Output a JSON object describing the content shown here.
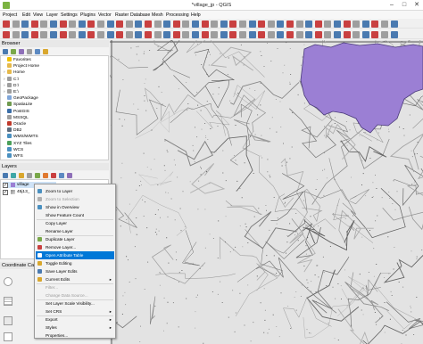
{
  "window": {
    "title": "*village_jp - QGIS",
    "minimize": "–",
    "maximize": "□",
    "close": "✕"
  },
  "menu": [
    "Project",
    "Edit",
    "View",
    "Layer",
    "Settings",
    "Plugins",
    "Vector",
    "Raster",
    "Database",
    "Mesh",
    "Processing",
    "Help"
  ],
  "browser": {
    "title": "Browser",
    "items": [
      {
        "label": "Favorites",
        "icon": "star-icon",
        "color": "#f2c200",
        "arrow": ""
      },
      {
        "label": "Project Home",
        "icon": "folder-icon",
        "color": "#e6b94a",
        "arrow": ""
      },
      {
        "label": "Home",
        "icon": "folder-icon",
        "color": "#e6b94a",
        "arrow": "›"
      },
      {
        "label": "C:\\",
        "icon": "drive-icon",
        "color": "#9e9e9e",
        "arrow": "›"
      },
      {
        "label": "D:\\",
        "icon": "drive-icon",
        "color": "#9e9e9e",
        "arrow": "›"
      },
      {
        "label": "E:\\",
        "icon": "drive-icon",
        "color": "#9e9e9e",
        "arrow": "›"
      },
      {
        "label": "GeoPackage",
        "icon": "geopackage-icon",
        "color": "#7fa6d9",
        "arrow": ""
      },
      {
        "label": "SpatiaLite",
        "icon": "spatialite-icon",
        "color": "#6f9a4f",
        "arrow": ""
      },
      {
        "label": "PostGIS",
        "icon": "postgis-icon",
        "color": "#3b6ea8",
        "arrow": ""
      },
      {
        "label": "MSSQL",
        "icon": "mssql-icon",
        "color": "#9e9e9e",
        "arrow": ""
      },
      {
        "label": "Oracle",
        "icon": "oracle-icon",
        "color": "#c0392b",
        "arrow": ""
      },
      {
        "label": "DB2",
        "icon": "db2-icon",
        "color": "#5d6d7e",
        "arrow": ""
      },
      {
        "label": "WMS/WMTS",
        "icon": "globe-icon",
        "color": "#4a90c0",
        "arrow": ""
      },
      {
        "label": "XYZ Tiles",
        "icon": "tiles-icon",
        "color": "#4aa05a",
        "arrow": ""
      },
      {
        "label": "WCS",
        "icon": "globe-icon",
        "color": "#4a90c0",
        "arrow": ""
      },
      {
        "label": "WFS",
        "icon": "globe-icon",
        "color": "#4a90c0",
        "arrow": ""
      }
    ]
  },
  "layers": {
    "title": "Layers",
    "items": [
      {
        "label": "village",
        "checked": "✓"
      },
      {
        "label": "45j13_",
        "checked": "✓"
      }
    ]
  },
  "coord_panel": {
    "title": "Coordinate Capt"
  },
  "context_menu": [
    {
      "label": "Zoom to Layer",
      "icon": "zoom-layer-icon",
      "color": "#4a90c0",
      "state": "normal",
      "sub": ""
    },
    {
      "label": "Zoom to Selection",
      "icon": "zoom-selection-icon",
      "color": "#b0b0b0",
      "state": "disabled",
      "sub": ""
    },
    {
      "label": "Show in Overview",
      "icon": "overview-icon",
      "color": "#4a90c0",
      "state": "normal",
      "sub": ""
    },
    {
      "label": "Show Feature Count",
      "icon": "",
      "color": "",
      "state": "normal",
      "sub": ""
    },
    {
      "label": "Copy Layer",
      "icon": "",
      "color": "",
      "state": "normal",
      "sub": ""
    },
    {
      "label": "Rename Layer",
      "icon": "",
      "color": "",
      "state": "normal",
      "sub": ""
    },
    {
      "label": "Duplicate Layer",
      "icon": "duplicate-icon",
      "color": "#7aa84a",
      "state": "normal",
      "sub": ""
    },
    {
      "label": "Remove Layer...",
      "icon": "remove-icon",
      "color": "#c94040",
      "state": "normal",
      "sub": ""
    },
    {
      "label": "Open Attribute Table",
      "icon": "table-icon",
      "color": "#ffffff",
      "state": "highlighted",
      "sub": ""
    },
    {
      "label": "Toggle Editing",
      "icon": "pencil-icon",
      "color": "#d9a72e",
      "state": "normal",
      "sub": ""
    },
    {
      "label": "Save Layer Edits",
      "icon": "save-icon",
      "color": "#4a7ab0",
      "state": "normal",
      "sub": ""
    },
    {
      "label": "Current Edits",
      "icon": "edits-icon",
      "color": "#d9a72e",
      "state": "normal",
      "sub": "▸"
    },
    {
      "label": "Filter...",
      "icon": "",
      "color": "",
      "state": "disabled",
      "sub": ""
    },
    {
      "label": "Change Data Source...",
      "icon": "",
      "color": "",
      "state": "disabled",
      "sub": ""
    },
    {
      "label": "Set Layer Scale Visibility...",
      "icon": "",
      "color": "",
      "state": "normal",
      "sub": ""
    },
    {
      "label": "Set CRS",
      "icon": "",
      "color": "",
      "state": "normal",
      "sub": "▸"
    },
    {
      "label": "Export",
      "icon": "",
      "color": "",
      "state": "normal",
      "sub": "▸"
    },
    {
      "label": "Styles",
      "icon": "",
      "color": "",
      "state": "normal",
      "sub": "▸"
    },
    {
      "label": "Properties...",
      "icon": "",
      "color": "",
      "state": "normal",
      "sub": ""
    }
  ],
  "colors": {
    "polygon_fill": "#9b7fd4",
    "polygon_stroke": "#4a3a7a",
    "highlight": "#0078d7",
    "map_bg": "#e3e3e3"
  }
}
